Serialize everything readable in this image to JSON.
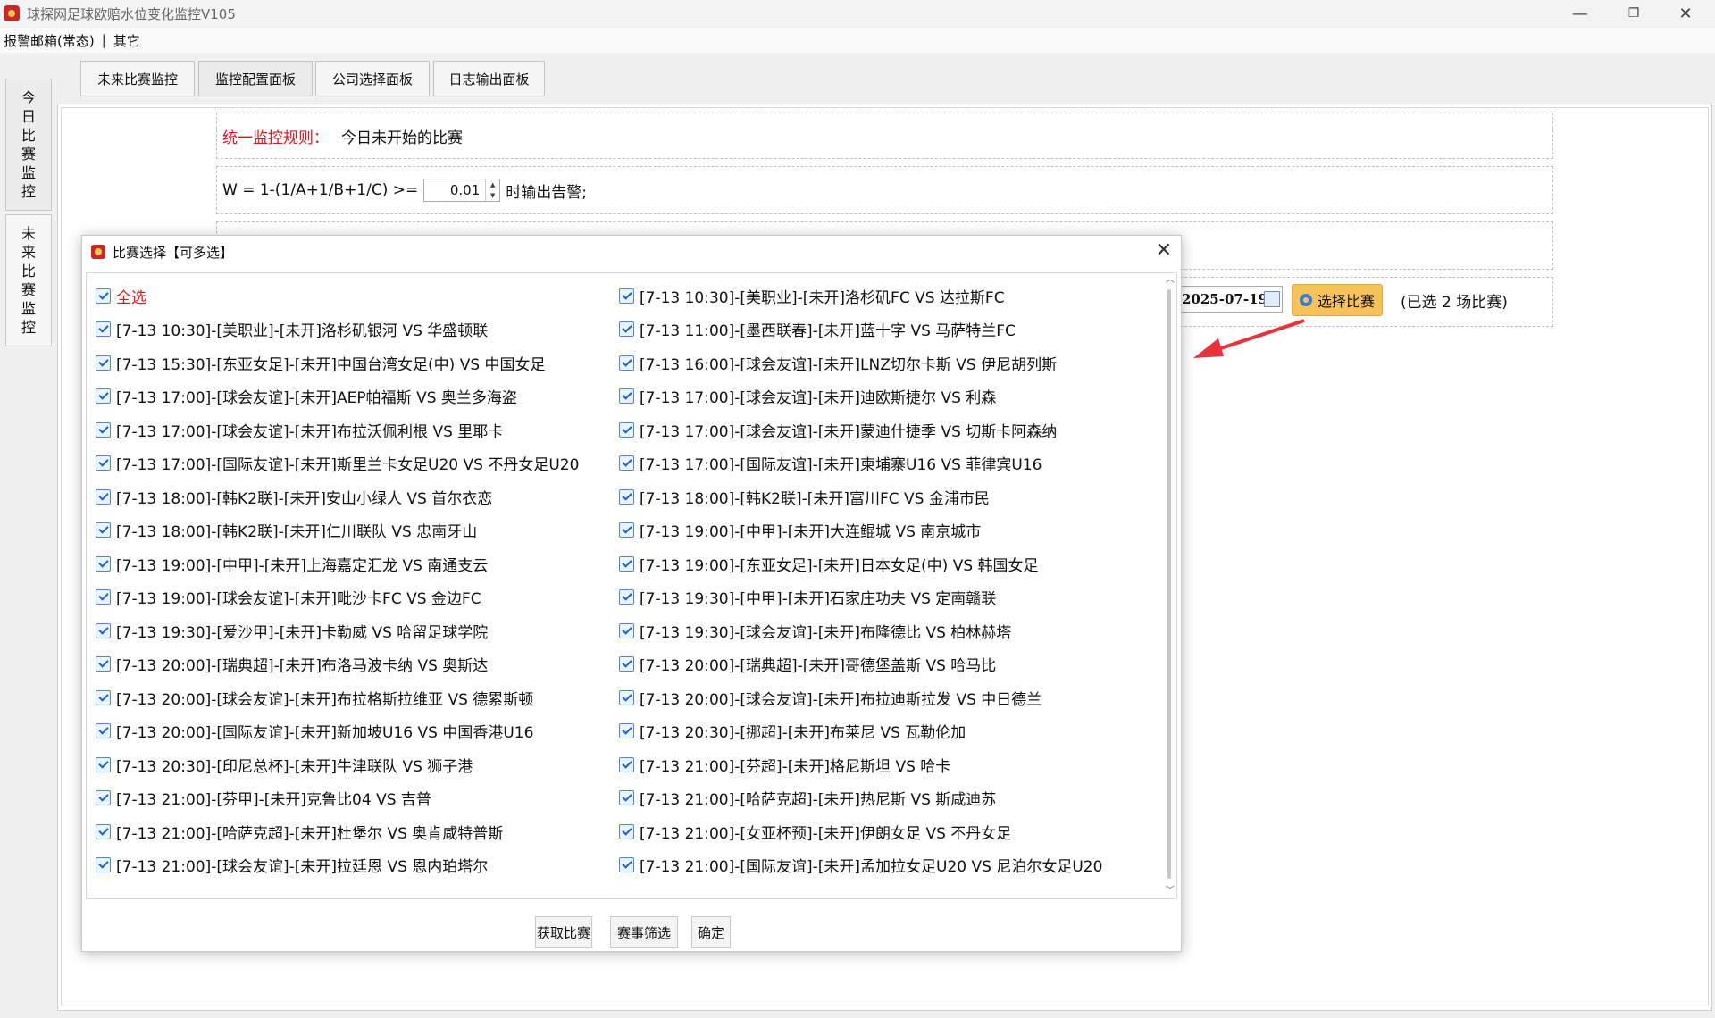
{
  "window": {
    "title": "球探网足球欧赔水位变化监控V105",
    "minimize": "—",
    "maximize": "❐",
    "close": "✕"
  },
  "menu": {
    "item1": "报警邮箱(常态)",
    "separator": "|",
    "item2": "其它"
  },
  "side_tabs": [
    {
      "label": "今\n日\n比\n赛\n监\n控"
    },
    {
      "label": "未\n来\n比\n赛\n监\n控"
    }
  ],
  "top_tabs": [
    "未来比赛监控",
    "监控配置面板",
    "公司选择面板",
    "日志输出面板"
  ],
  "panel": {
    "rule_title": "统一监控规则：",
    "rule_value": "今日未开始的比赛",
    "formula": "W = 1-(1/A+1/B+1/C) >=",
    "threshold": "0.01",
    "formula_suffix": "时输出告警;",
    "date": "2025-07-19",
    "select_button": "选择比赛",
    "selected_count": "(已选 2 场比赛)"
  },
  "dialog": {
    "title": "比赛选择【可多选】",
    "close": "✕",
    "select_all": "全选",
    "left_items": [
      "[7-13 10:30]-[美职业]-[未开]洛杉矶银河 VS 华盛顿联",
      "[7-13 15:30]-[东亚女足]-[未开]中国台湾女足(中) VS 中国女足",
      "[7-13 17:00]-[球会友谊]-[未开]AEP帕福斯 VS 奥兰多海盗",
      "[7-13 17:00]-[球会友谊]-[未开]布拉沃佩利根 VS 里耶卡",
      "[7-13 17:00]-[国际友谊]-[未开]斯里兰卡女足U20 VS 不丹女足U20",
      "[7-13 18:00]-[韩K2联]-[未开]安山小绿人 VS 首尔衣恋",
      "[7-13 18:00]-[韩K2联]-[未开]仁川联队 VS 忠南牙山",
      "[7-13 19:00]-[中甲]-[未开]上海嘉定汇龙 VS 南通支云",
      "[7-13 19:00]-[球会友谊]-[未开]毗沙卡FC VS 金边FC",
      "[7-13 19:30]-[爱沙甲]-[未开]卡勒威 VS 哈留足球学院",
      "[7-13 20:00]-[瑞典超]-[未开]布洛马波卡纳 VS 奥斯达",
      "[7-13 20:00]-[球会友谊]-[未开]布拉格斯拉维亚 VS 德累斯顿",
      "[7-13 20:00]-[国际友谊]-[未开]新加坡U16 VS 中国香港U16",
      "[7-13 20:30]-[印尼总杯]-[未开]牛津联队 VS 狮子港",
      "[7-13 21:00]-[芬甲]-[未开]克鲁比04 VS 吉普",
      "[7-13 21:00]-[哈萨克超]-[未开]杜堡尔 VS 奥肯咸特普斯",
      "[7-13 21:00]-[球会友谊]-[未开]拉廷恩 VS 恩内珀塔尔"
    ],
    "right_items": [
      "[7-13 10:30]-[美职业]-[未开]洛杉矶FC VS 达拉斯FC",
      "[7-13 11:00]-[墨西联春]-[未开]蓝十字 VS 马萨特兰FC",
      "[7-13 16:00]-[球会友谊]-[未开]LNZ切尔卡斯 VS 伊尼胡列斯",
      "[7-13 17:00]-[球会友谊]-[未开]迪欧斯捷尔 VS 利森",
      "[7-13 17:00]-[球会友谊]-[未开]蒙迪什捷季 VS 切斯卡阿森纳",
      "[7-13 17:00]-[国际友谊]-[未开]柬埔寨U16 VS 菲律宾U16",
      "[7-13 18:00]-[韩K2联]-[未开]富川FC VS 金浦市民",
      "[7-13 19:00]-[中甲]-[未开]大连鲲城 VS 南京城市",
      "[7-13 19:00]-[东亚女足]-[未开]日本女足(中) VS 韩国女足",
      "[7-13 19:30]-[中甲]-[未开]石家庄功夫 VS 定南赣联",
      "[7-13 19:30]-[球会友谊]-[未开]布隆德比 VS 柏林赫塔",
      "[7-13 20:00]-[瑞典超]-[未开]哥德堡盖斯 VS 哈马比",
      "[7-13 20:00]-[球会友谊]-[未开]布拉迪斯拉发 VS 中日德兰",
      "[7-13 20:30]-[挪超]-[未开]布莱尼 VS 瓦勒伦加",
      "[7-13 21:00]-[芬超]-[未开]格尼斯坦 VS 哈卡",
      "[7-13 21:00]-[哈萨克超]-[未开]热尼斯 VS 斯咸迪苏",
      "[7-13 21:00]-[女亚杯预]-[未开]伊朗女足 VS 不丹女足",
      "[7-13 21:00]-[国际友谊]-[未开]孟加拉女足U20 VS 尼泊尔女足U20"
    ],
    "buttons": [
      "获取比赛",
      "赛事筛选",
      "确定"
    ]
  },
  "colors": {
    "accent_red": "#e0141e",
    "select_button_bg": "#f5c35a",
    "arrow": "#e8323c"
  }
}
